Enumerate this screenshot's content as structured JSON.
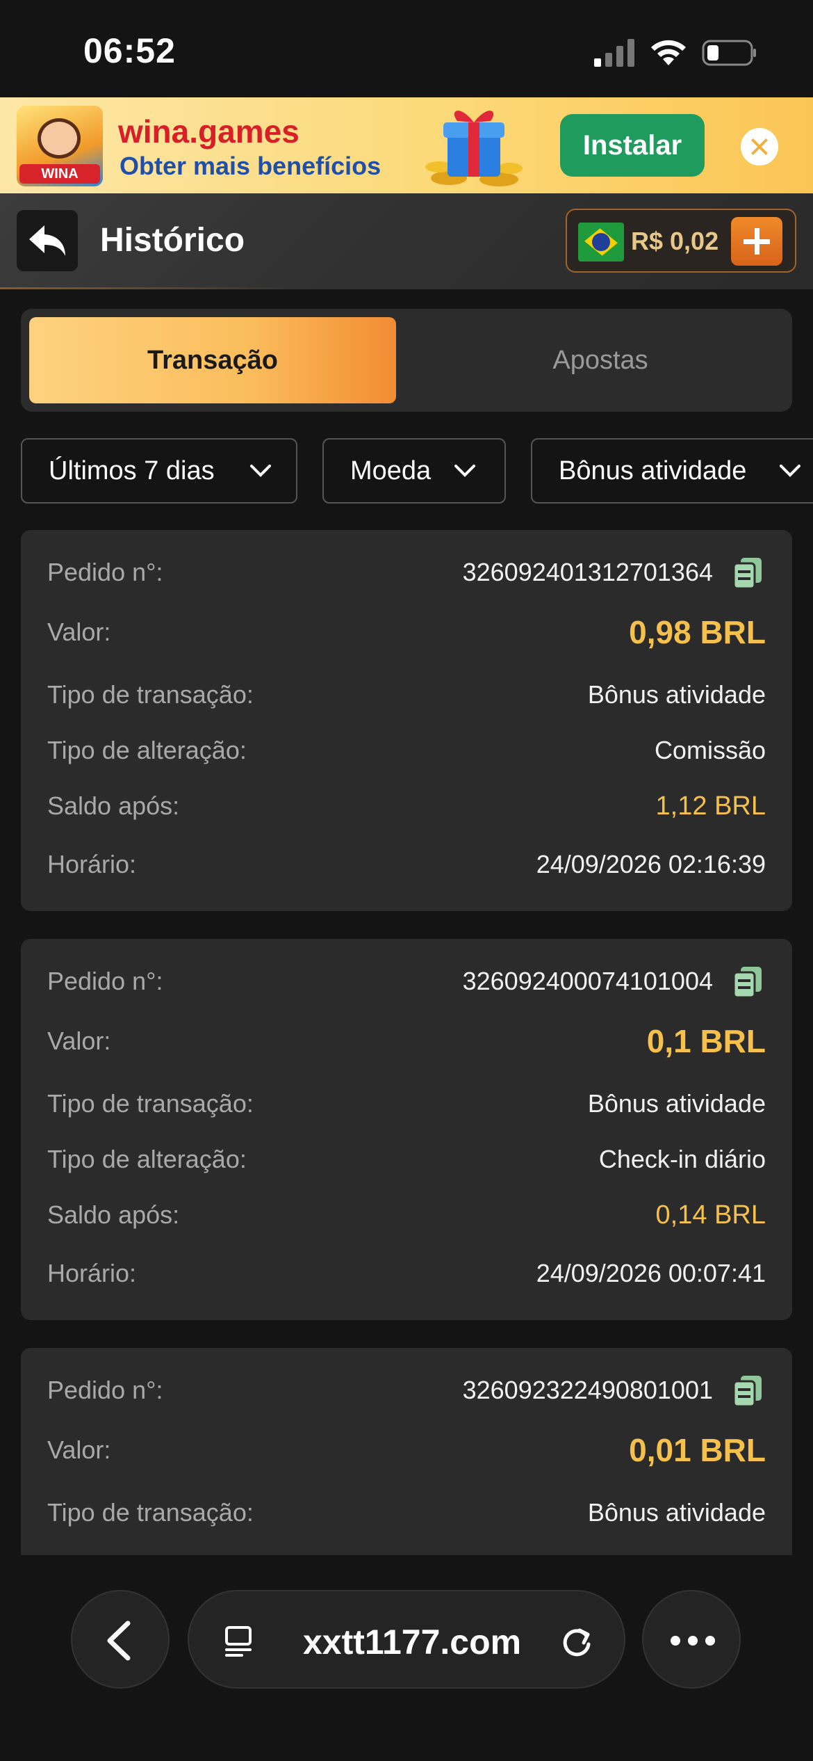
{
  "status_bar": {
    "time": "06:52",
    "signal_icon": "cellular-signal-icon",
    "wifi_icon": "wifi-icon",
    "battery_icon": "battery-icon"
  },
  "banner": {
    "app_name": "wina.games",
    "subtitle": "Obter mais benefícios",
    "logo_tag": "WINA",
    "install_label": "Instalar",
    "gift_icon": "gift-box-icon",
    "close_icon": "close-icon"
  },
  "header": {
    "title": "Histórico",
    "back_icon": "back-arrow-icon",
    "balance": "R$ 0,02",
    "flag_icon": "brazil-flag-icon",
    "deposit_icon": "plus-icon"
  },
  "tabs": [
    {
      "label": "Transação",
      "active": true
    },
    {
      "label": "Apostas",
      "active": false
    }
  ],
  "filters": [
    {
      "label": "Últimos 7 dias"
    },
    {
      "label": "Moeda"
    },
    {
      "label": "Bônus atividade"
    }
  ],
  "labels": {
    "order": "Pedido n°:",
    "amount": "Valor:",
    "tx_type": "Tipo de transação:",
    "change_type": "Tipo de alteração:",
    "balance_after": "Saldo após:",
    "time": "Horário:"
  },
  "transactions": [
    {
      "order_no": "326092401312701364",
      "amount": "0,98 BRL",
      "tx_type": "Bônus atividade",
      "change_type": "Comissão",
      "balance_after": "1,12 BRL",
      "time": "24/09/2026 02:16:39"
    },
    {
      "order_no": "326092400074101004",
      "amount": "0,1 BRL",
      "tx_type": "Bônus atividade",
      "change_type": "Check-in diário",
      "balance_after": "0,14 BRL",
      "time": "24/09/2026 00:07:41"
    },
    {
      "order_no": "326092322490801001",
      "amount": "0,01 BRL",
      "tx_type": "Bônus atividade"
    }
  ],
  "browser": {
    "url": "xxtt1177.com",
    "back_icon": "chevron-left-icon",
    "tabs_icon": "page-menu-icon",
    "reload_icon": "reload-icon",
    "more_icon": "more-icon"
  },
  "colors": {
    "accent": "#f6c04d",
    "tab_gradient_start": "#fdd27f",
    "tab_gradient_end": "#f28c33",
    "install_green": "#1f9b5e",
    "background": "#141414",
    "card": "#2b2b2b"
  }
}
